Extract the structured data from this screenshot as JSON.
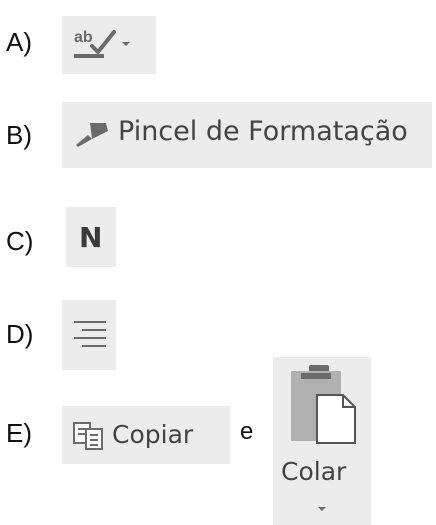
{
  "options": [
    {
      "letter": "A)"
    },
    {
      "letter": "B)",
      "button_label": "Pincel de Formatação"
    },
    {
      "letter": "C)",
      "button_label": "N"
    },
    {
      "letter": "D)"
    },
    {
      "letter": "E)",
      "copy_label": "Copiar",
      "connector": "e",
      "paste_label": "Colar"
    }
  ],
  "icons": {
    "A": "spelling-check-icon",
    "A_dropdown": "chevron-down-icon",
    "B": "format-painter-icon",
    "D": "align-right-icon",
    "E_copy": "copy-icon",
    "E_paste": "paste-clipboard-icon",
    "E_dropdown": "chevron-down-icon"
  },
  "colors": {
    "ribbon_bg": "#ececec",
    "icon_gray": "#6b6b6b",
    "text": "#111111"
  }
}
